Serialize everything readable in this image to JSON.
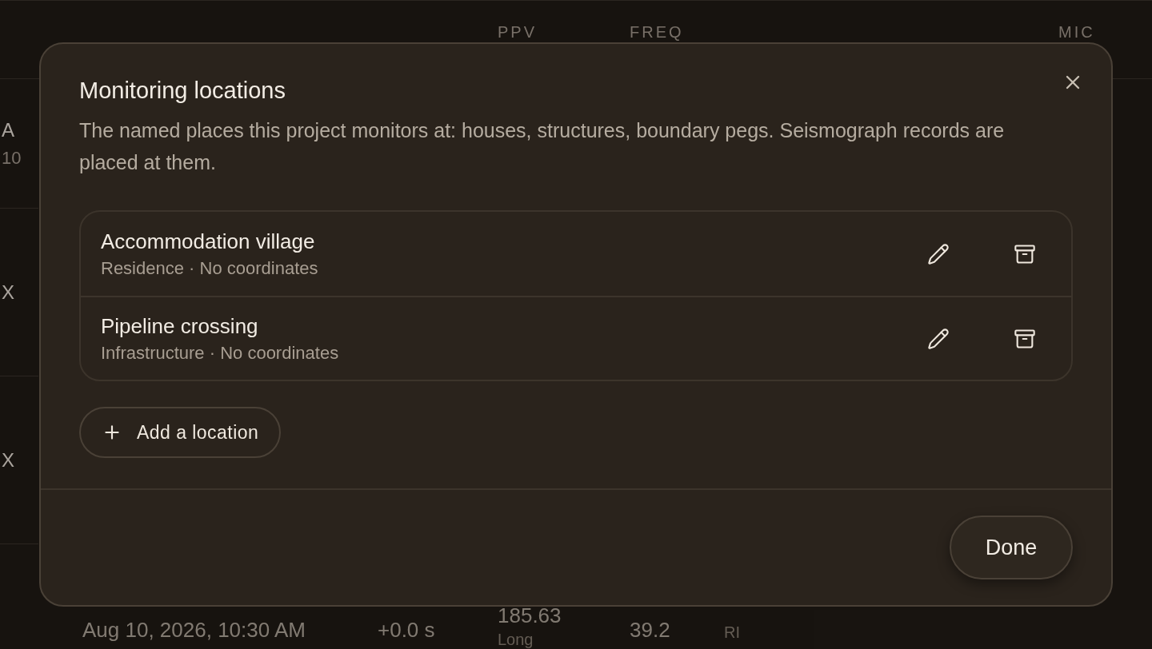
{
  "background_table": {
    "headers": {
      "ppv": "PPV",
      "freq": "FREQ",
      "mic": "MIC"
    },
    "row_fragments": [
      [
        "A",
        "10"
      ],
      [
        "X"
      ],
      [
        "X"
      ]
    ],
    "last_row": {
      "trigger": "Aug 10, 2026, 10:30 AM",
      "offset": "+0.0 s",
      "ppv": "185.63",
      "ppv_note": "Long",
      "freq": "39.2",
      "limit": "RI"
    }
  },
  "dialog": {
    "title": "Monitoring locations",
    "description": "The named places this project monitors at: houses, structures, boundary pegs. Seismograph records are placed at them.",
    "locations": [
      {
        "name": "Accommodation village",
        "details": "Residence · No coordinates"
      },
      {
        "name": "Pipeline crossing",
        "details": "Infrastructure · No coordinates"
      }
    ],
    "add_button": "Add a location",
    "done_button": "Done"
  }
}
